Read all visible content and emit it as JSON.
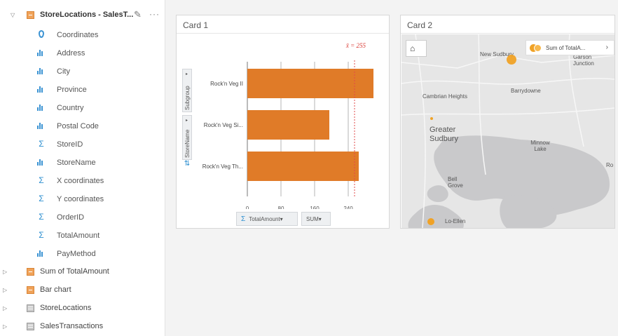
{
  "data_pane": {
    "dataset_title": "StoreLocations - SalesT...",
    "fields": [
      {
        "label": "Coordinates",
        "icon": "location-icon"
      },
      {
        "label": "Address",
        "icon": "string-field-icon"
      },
      {
        "label": "City",
        "icon": "string-field-icon"
      },
      {
        "label": "Province",
        "icon": "string-field-icon"
      },
      {
        "label": "Country",
        "icon": "string-field-icon"
      },
      {
        "label": "Postal Code",
        "icon": "string-field-icon"
      },
      {
        "label": "StoreID",
        "icon": "sigma-icon"
      },
      {
        "label": "StoreName",
        "icon": "string-field-icon"
      },
      {
        "label": "X coordinates",
        "icon": "sigma-icon"
      },
      {
        "label": "Y coordinates",
        "icon": "sigma-icon"
      },
      {
        "label": "OrderID",
        "icon": "sigma-icon"
      },
      {
        "label": "TotalAmount",
        "icon": "sigma-icon"
      },
      {
        "label": "PayMethod",
        "icon": "string-field-icon"
      }
    ],
    "layers": [
      {
        "label": "Sum of TotalAmount",
        "icon": "result-dataset-icon"
      },
      {
        "label": "Bar chart",
        "icon": "result-dataset-icon"
      },
      {
        "label": "StoreLocations",
        "icon": "table-icon"
      },
      {
        "label": "SalesTransactions",
        "icon": "table-icon"
      }
    ]
  },
  "card1": {
    "title": "Card 1",
    "subgroup_label": "Subgroup",
    "y_field_label": "StoreName",
    "x_field_button": "TotalAmount",
    "stat_button": "SUM",
    "mean_label": "x̄ = 255"
  },
  "card2": {
    "title": "Card 2",
    "legend_label": "Sum of TotalA...",
    "places": [
      "New Sudbury",
      "Garson Junction",
      "Cambrian Heights",
      "Barrydowne",
      "Greater Sudbury",
      "Minnow Lake",
      "Bell Grove",
      "Lo-Ellen",
      "Ro"
    ],
    "colors": {
      "point": "#f0a226",
      "water": "#c9c9cb",
      "land": "#e7e7e8"
    }
  },
  "chart_data": {
    "type": "bar",
    "orientation": "horizontal",
    "categories": [
      "Rock'n Veg II",
      "Rock'n Veg Si...",
      "Rock'n Veg Th..."
    ],
    "values": [
      300,
      195,
      265
    ],
    "tick_labels": [
      "0",
      "80",
      "160",
      "240"
    ],
    "xlim": [
      0,
      300
    ],
    "mean": 255,
    "bar_color": "#e07b28"
  }
}
